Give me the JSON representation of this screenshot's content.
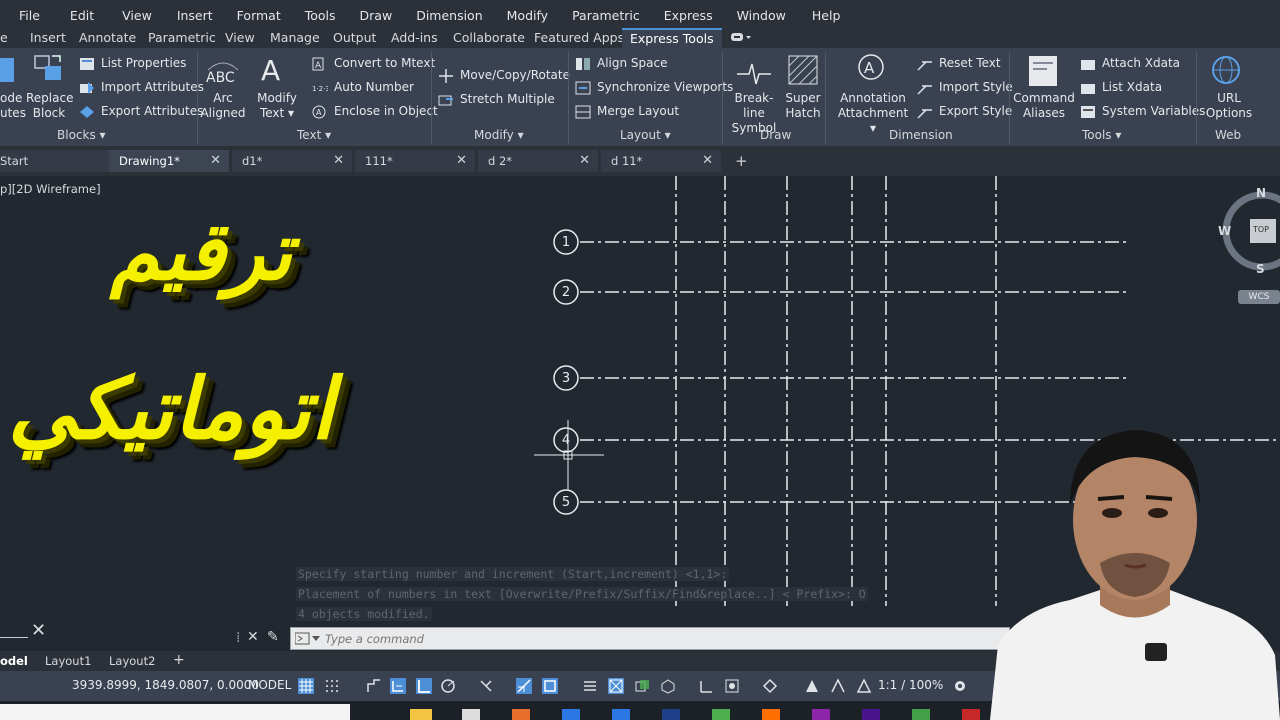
{
  "menu": [
    "File",
    "Edit",
    "View",
    "Insert",
    "Format",
    "Tools",
    "Draw",
    "Dimension",
    "Modify",
    "Parametric",
    "Express",
    "Window",
    "Help"
  ],
  "ribbon_tabs": [
    "e",
    "Insert",
    "Annotate",
    "Parametric",
    "View",
    "Manage",
    "Output",
    "Add-ins",
    "Collaborate",
    "Featured Apps",
    "Express Tools"
  ],
  "ribbon": {
    "blocks": {
      "partial_a": "ode",
      "partial_b": "utes",
      "replace_block_1": "Replace",
      "replace_block_2": "Block",
      "list_properties": "List Properties",
      "import_attributes": "Import Attributes",
      "export_attributes": "Export Attributes",
      "label": "Blocks"
    },
    "text": {
      "arc_aligned_1": "Arc",
      "arc_aligned_2": "Aligned",
      "modify_text_1": "Modify",
      "modify_text_2": "Text",
      "convert_to_mtext": "Convert to Mtext",
      "auto_number": "Auto Number",
      "enclose_in_object": "Enclose in Object",
      "label": "Text"
    },
    "modify": {
      "move_copy_rotate": "Move/Copy/Rotate",
      "stretch_multiple": "Stretch Multiple",
      "label": "Modify"
    },
    "layout": {
      "align_space": "Align Space",
      "synchronize_viewports": "Synchronize Viewports",
      "merge_layout": "Merge Layout",
      "label": "Layout"
    },
    "draw": {
      "break_line_1": "Break-line",
      "break_line_2": "Symbol",
      "super_hatch_1": "Super",
      "super_hatch_2": "Hatch",
      "label": "Draw"
    },
    "dimension": {
      "annotation_1": "Annotation",
      "annotation_2": "Attachment",
      "reset_text": "Reset Text",
      "import_style": "Import Style",
      "export_style": "Export Style",
      "label": "Dimension"
    },
    "tools": {
      "command_aliases_1": "Command",
      "command_aliases_2": "Aliases",
      "attach_xdata": "Attach Xdata",
      "list_xdata": "List Xdata",
      "system_variables": "System Variables",
      "label": "Tools"
    },
    "web": {
      "url_options_1": "URL",
      "url_options_2": "Options",
      "label": "Web"
    }
  },
  "doc_tabs": [
    "Start",
    "Drawing1*",
    "d1*",
    "111*",
    "d 2*",
    "d 11*"
  ],
  "view_label": "p][2D Wireframe]",
  "overlay": {
    "line1": "ترقيم",
    "line2": "اتوماتيكي"
  },
  "grid_bubbles": [
    "1",
    "2",
    "3",
    "4",
    "5"
  ],
  "viewcube": {
    "n": "N",
    "w": "W",
    "s": "S",
    "top": "TOP",
    "wcs": "WCS"
  },
  "command": {
    "history": [
      "Specify starting number and increment (Start,increment) <1,1>:",
      "Placement of numbers in text [Overwrite/Prefix/Suffix/Find&replace..] < Prefix>: O",
      "4 objects modified."
    ],
    "placeholder": "Type a command"
  },
  "layout_tabs": [
    "odel",
    "Layout1",
    "Layout2"
  ],
  "status": {
    "coords": "3939.8999, 1849.0807, 0.0000",
    "model": "MODEL",
    "scale": "1:1 / 100%"
  }
}
